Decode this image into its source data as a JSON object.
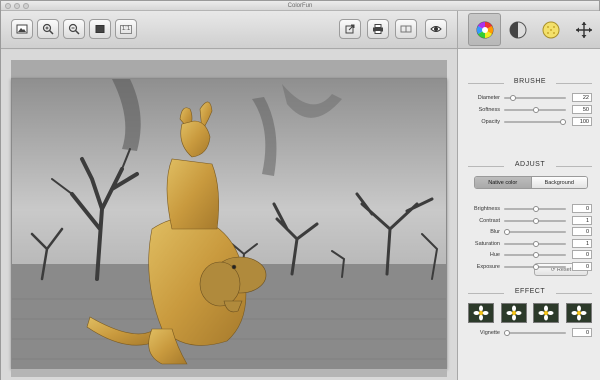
{
  "app": {
    "title": "ColorFun"
  },
  "toolbar": {
    "buttons": [
      {
        "name": "open-image-button",
        "icon": "image-icon"
      },
      {
        "name": "zoom-in-button",
        "icon": "zoom-in-icon"
      },
      {
        "name": "zoom-out-button",
        "icon": "zoom-out-icon"
      },
      {
        "name": "fit-to-window-button",
        "icon": "fit-icon"
      },
      {
        "name": "actual-size-button",
        "icon": "actual-size-icon",
        "label": "1:1"
      },
      {
        "name": "export-button",
        "icon": "export-icon"
      },
      {
        "name": "print-button",
        "icon": "printer-icon"
      },
      {
        "name": "compare-button",
        "icon": "compare-icon"
      },
      {
        "name": "preview-button",
        "icon": "eye-icon"
      }
    ]
  },
  "panel": {
    "tabs": [
      {
        "name": "color-wheel-tab",
        "icon": "color-wheel-icon",
        "active": true
      },
      {
        "name": "grayscale-tab",
        "icon": "half-circle-icon",
        "active": false
      },
      {
        "name": "texture-tab",
        "icon": "yellow-dots-icon",
        "active": false
      },
      {
        "name": "move-tab",
        "icon": "move-arrows-icon",
        "active": false
      }
    ],
    "brushe": {
      "title": "BRUSHE",
      "rows": [
        {
          "label": "Diameter",
          "value": "22",
          "fraction": 0.1
        },
        {
          "label": "Softness",
          "value": "50",
          "fraction": 0.5
        },
        {
          "label": "Opacity",
          "value": "100",
          "fraction": 0.97
        }
      ]
    },
    "adjust": {
      "title": "ADJUST",
      "segments": [
        "Native color",
        "Background"
      ],
      "selected_segment": "Native color",
      "rows": [
        {
          "label": "Brightness",
          "value": "0",
          "fraction": 0.5
        },
        {
          "label": "Contrast",
          "value": "1",
          "fraction": 0.5
        },
        {
          "label": "Blur",
          "value": "0",
          "fraction": 0.0
        },
        {
          "label": "Saturation",
          "value": "1",
          "fraction": 0.5
        },
        {
          "label": "Hue",
          "value": "0",
          "fraction": 0.5
        },
        {
          "label": "Exposure",
          "value": "0",
          "fraction": 0.5
        }
      ],
      "reset_label": "Reset"
    },
    "effect": {
      "title": "EFFECT",
      "thumbnails": [
        "flower-preset-1",
        "flower-preset-2",
        "flower-preset-3",
        "flower-preset-4"
      ],
      "vignette": {
        "label": "Vignette",
        "value": "0",
        "fraction": 0.0
      }
    }
  },
  "colors": {
    "accent": "#6e6e6e",
    "kangaroo": "#c9a44a",
    "background_gray": "#9a9a9a"
  }
}
